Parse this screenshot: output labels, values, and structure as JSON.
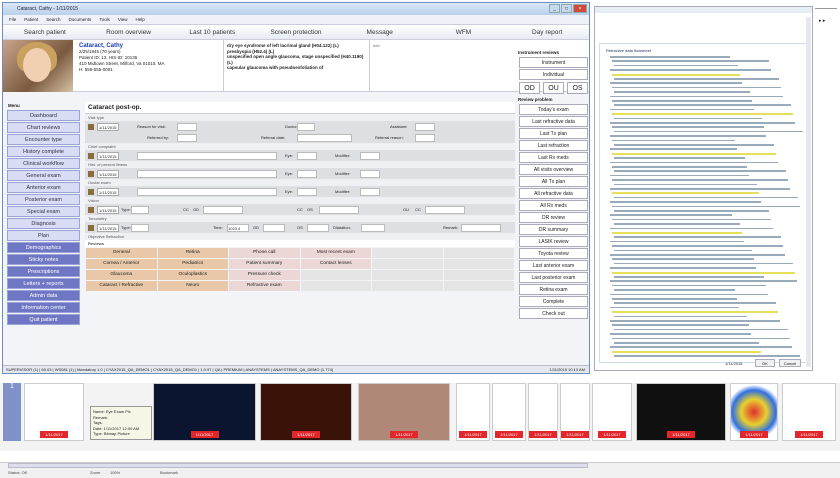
{
  "window": {
    "title": "Cataract, Cathy - 1/11/2015",
    "controls": [
      "_",
      "□",
      "×"
    ]
  },
  "menu": [
    "File",
    "Patient",
    "Search",
    "Documents",
    "Tools",
    "View",
    "Help"
  ],
  "nav": [
    "Search patient",
    "Room overview",
    "Last 10 patients",
    "Screen protection",
    "Message",
    "WFM",
    "Day report"
  ],
  "patient": {
    "name": "Cataract, Cathy",
    "lines": [
      "2/25/1945 (70 years)",
      "Patient ID: 13, HIS-ID: 10136",
      "410 Midtown Street, Milford, Va 01010, MA",
      "H: 555-555-0001"
    ]
  },
  "diagnoses": [
    "dry eye syndrome of left lacrimal gland (H04.122) (L)",
    "presbyopia (H52.4) (L)",
    "unspecified open angle glaucoma, stage unspecified (H40.1190) (L)",
    "capsular glaucoma with pseudoexfoliation of"
  ],
  "notes_label": "Info",
  "right": {
    "latest_title": "Instrument reviews",
    "buttons": [
      "Instrument",
      "Individual"
    ],
    "eyes": [
      "OD",
      "OU",
      "OS"
    ],
    "review_title": "Review problem",
    "reviews": [
      "Today's exam",
      "Last refractive data",
      "Last Tx plan",
      "Last refraction",
      "Last Rx meds",
      "All visits overview",
      "All Tx plan",
      "All refractive data",
      "All Rx meds",
      "DR review",
      "DR summary",
      "LASIK review",
      "Toyota review",
      "Last anterior exam",
      "Last posterior exam",
      "Retina exam",
      "Complete",
      "Check out"
    ]
  },
  "leftmenu": {
    "title": "Menu",
    "items": [
      "Dashboard",
      "Chart reviews",
      "Encounter type",
      "History complete",
      "Clinical workflow",
      "General exam",
      "Anterior exam",
      "Posterior exam",
      "Special exam",
      "Diagnosis",
      "Plan",
      "Demographics",
      "Sticky notes",
      "Prescriptions",
      "Letters + reports",
      "Admin data",
      "Information center",
      "Quit patient"
    ]
  },
  "center": {
    "title": "Cataract post-op.",
    "sections": [
      "Visit type",
      "Chief complaint",
      "Hist. of present illness",
      "Ocular exam",
      "Vision",
      "Tonometry",
      "Objective Refraction"
    ],
    "date": "1/11/2015",
    "labels": {
      "reason": "Reason for visit:",
      "doctor": "Doctor:",
      "assistant": "Assistant:",
      "referredby": "Referred by:",
      "referraldate": "Referral date:",
      "referralreason": "Referral reason:",
      "eye": "Eye:",
      "modifier": "Modifier:",
      "type": "Type:",
      "time": "Time:",
      "dilation": "Dilatation:",
      "remark": "Remark:",
      "cc": "CC",
      "sc": "SC",
      "od": "OD",
      "os": "OS",
      "ou": "OU",
      "time_val": "1023.4"
    },
    "reviews_title": "Reviews",
    "reviews": [
      [
        "General",
        "Retina",
        "Phone call",
        "Most recent exam",
        "",
        ""
      ],
      [
        "Cornea / Anterior",
        "Pediatrics",
        "Patient summary",
        "Contact lenses",
        "",
        ""
      ],
      [
        "Glaucoma",
        "Oculoplastics",
        "Pressure check",
        "",
        "",
        ""
      ],
      [
        "Cataract / Refractive",
        "Neuro",
        "Refractive exam",
        "",
        "",
        ""
      ]
    ]
  },
  "status": "SUPERVISOR (1) | 65.03 | WS081 (1) | Mandatory 1.0 | CYAX2015_QA_DEMO1 | CYAX2015_QA_DEMO1 | 1.0.97 | QA | PREMIUM | ANAYSTEMS | ANAYSTEMS_QA_DEMO (1.774)",
  "status_right": "1/11/2015 10:13 AM",
  "doc": {
    "title": "Refractive data flowsheet",
    "ok": "OK",
    "cancel": "Cancel",
    "date": "1/11/2015"
  },
  "tooltip": [
    "Name: Eye Exam Pic",
    "Remark:",
    "Tags:",
    "Date: 1/11/2017 12:00 AM",
    "Type: Bitmap Picture"
  ],
  "thumb_tags": [
    "1/11/2017",
    "1/11/2017",
    "1/11/2017",
    "1/11/2017",
    "1/11/2017",
    "1/11/2017",
    "1/11/2017",
    "1/11/2017",
    "1/11/2017",
    "1/11/2017",
    "1/11/2017",
    "1/11/2017"
  ],
  "bottom": {
    "status": "Status: OK",
    "fields": [
      "Zoom",
      "100%",
      "Bookmark"
    ]
  }
}
